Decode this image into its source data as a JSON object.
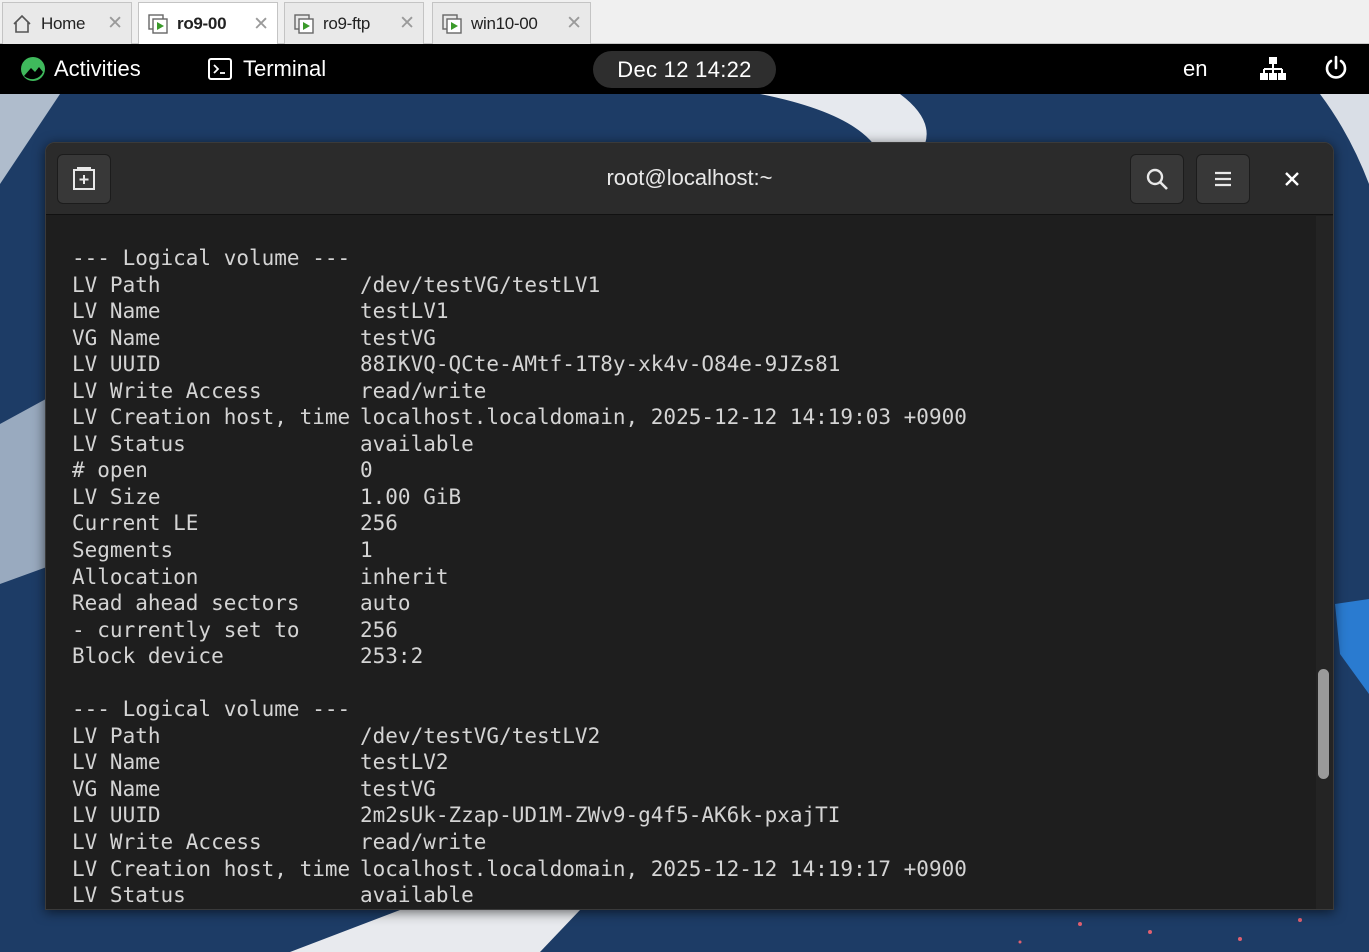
{
  "vm_tabs": [
    {
      "label": "Home",
      "icon": "home-icon",
      "active": false
    },
    {
      "label": "ro9-00",
      "icon": "vm-icon",
      "active": true
    },
    {
      "label": "ro9-ftp",
      "icon": "vm-icon",
      "active": false
    },
    {
      "label": "win10-00",
      "icon": "vm-icon",
      "active": false
    }
  ],
  "close_glyph": "✕",
  "gnome": {
    "activities": "Activities",
    "app_name": "Terminal",
    "clock": "Dec 12  14:22",
    "lang": "en"
  },
  "terminal": {
    "title": "root@localhost:~",
    "lines": [
      {
        "t": "--- Logical volume ---"
      },
      {
        "k": "LV Path",
        "v": "/dev/testVG/testLV1"
      },
      {
        "k": "LV Name",
        "v": "testLV1"
      },
      {
        "k": "VG Name",
        "v": "testVG"
      },
      {
        "k": "LV UUID",
        "v": "88IKVQ-QCte-AMtf-1T8y-xk4v-O84e-9JZs81"
      },
      {
        "k": "LV Write Access",
        "v": "read/write"
      },
      {
        "k": "LV Creation host, time",
        "v": "localhost.localdomain, 2025-12-12 14:19:03 +0900"
      },
      {
        "k": "LV Status",
        "v": "available"
      },
      {
        "k": "# open",
        "v": "0"
      },
      {
        "k": "LV Size",
        "v": "1.00 GiB"
      },
      {
        "k": "Current LE",
        "v": "256"
      },
      {
        "k": "Segments",
        "v": "1"
      },
      {
        "k": "Allocation",
        "v": "inherit"
      },
      {
        "k": "Read ahead sectors",
        "v": "auto"
      },
      {
        "k": "- currently set to",
        "v": "256"
      },
      {
        "k": "Block device",
        "v": "253:2"
      },
      {
        "t": ""
      },
      {
        "t": "--- Logical volume ---"
      },
      {
        "k": "LV Path",
        "v": "/dev/testVG/testLV2"
      },
      {
        "k": "LV Name",
        "v": "testLV2"
      },
      {
        "k": "VG Name",
        "v": "testVG"
      },
      {
        "k": "LV UUID",
        "v": "2m2sUk-Zzap-UD1M-ZWv9-g4f5-AK6k-pxajTI"
      },
      {
        "k": "LV Write Access",
        "v": "read/write"
      },
      {
        "k": "LV Creation host, time",
        "v": "localhost.localdomain, 2025-12-12 14:19:17 +0900"
      },
      {
        "k": "LV Status",
        "v": "available"
      }
    ]
  },
  "colors": {
    "desktop_bg": "#1d3c66",
    "terminal_bg": "#1e1e1e",
    "terminal_fg": "#d4d4d4",
    "headerbar_bg": "#2b2b2b",
    "accent_green": "#3fb95c"
  }
}
